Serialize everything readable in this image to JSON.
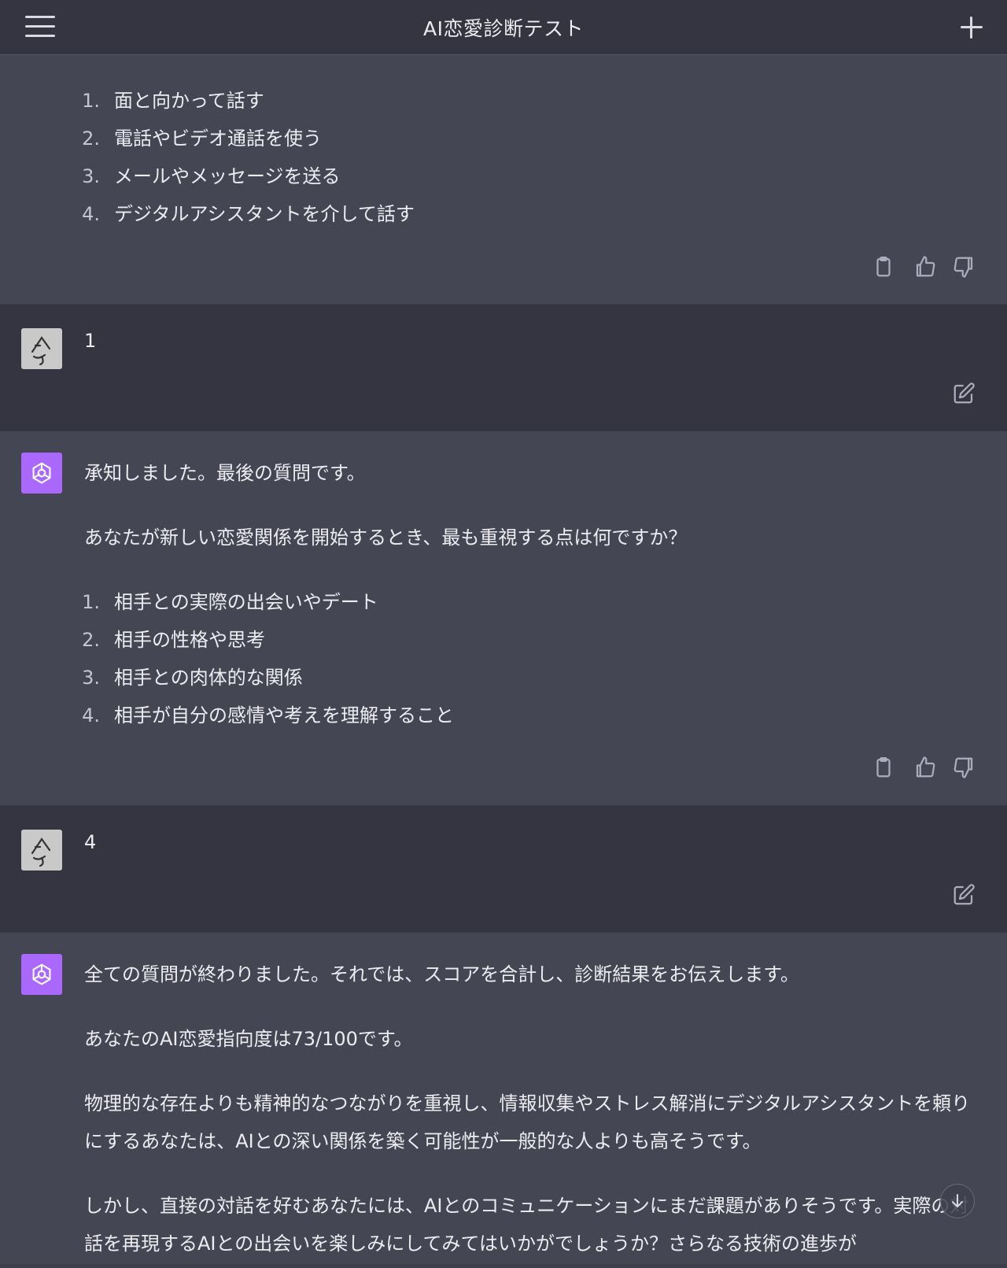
{
  "header": {
    "title": "AI恋愛診断テスト",
    "menu_icon": "hamburger-icon",
    "new_chat_icon": "plus-icon"
  },
  "messages": [
    {
      "role": "assistant",
      "list": [
        {
          "num": "1.",
          "text": "面と向かって話す"
        },
        {
          "num": "2.",
          "text": "電話やビデオ通話を使う"
        },
        {
          "num": "3.",
          "text": "メールやメッセージを送る"
        },
        {
          "num": "4.",
          "text": "デジタルアシスタントを介して話す"
        }
      ]
    },
    {
      "role": "user",
      "text": "1"
    },
    {
      "role": "assistant",
      "paragraphs": [
        "承知しました。最後の質問です。",
        "あなたが新しい恋愛関係を開始するとき、最も重視する点は何ですか？"
      ],
      "list": [
        {
          "num": "1.",
          "text": "相手との実際の出会いやデート"
        },
        {
          "num": "2.",
          "text": "相手の性格や思考"
        },
        {
          "num": "3.",
          "text": "相手との肉体的な関係"
        },
        {
          "num": "4.",
          "text": "相手が自分の感情や考えを理解すること"
        }
      ]
    },
    {
      "role": "user",
      "text": "4"
    },
    {
      "role": "assistant",
      "paragraphs": [
        "全ての質問が終わりました。それでは、スコアを合計し、診断結果をお伝えします。",
        "あなたのAI恋愛指向度は73/100です。",
        "物理的な存在よりも精神的なつながりを重視し、情報収集やストレス解消にデジタルアシスタントを頼りにするあなたは、AIとの深い関係を築く可能性が一般的な人よりも高そうです。",
        "しかし、直接の対話を好むあなたには、AIとのコミュニケーションにまだ課題がありそうです。実際の対話を再現するAIとの出会いを楽しみにしてみてはいかがでしょうか？さらなる技術の進歩が"
      ]
    }
  ],
  "icons": {
    "copy": "clipboard-icon",
    "like": "thumbs-up-icon",
    "dislike": "thumbs-down-icon",
    "edit": "edit-icon",
    "scroll": "arrow-down-icon"
  },
  "colors": {
    "assistant_bg": "#444654",
    "user_bg": "#343541",
    "ai_avatar": "#ab68ff"
  }
}
